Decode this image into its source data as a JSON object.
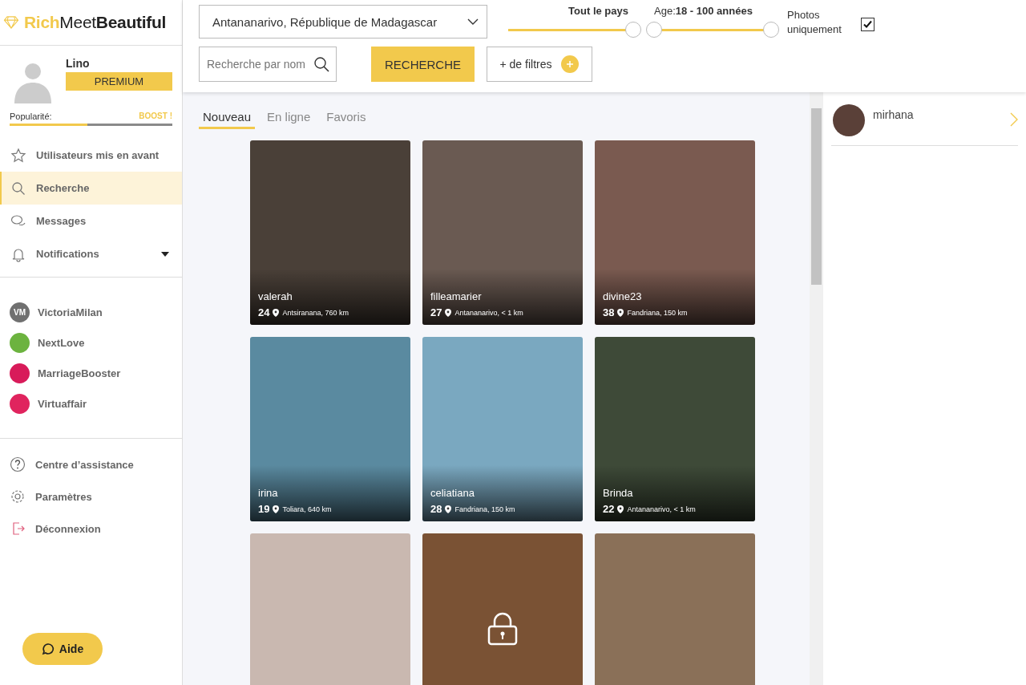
{
  "logo": {
    "part_1": "Rich",
    "part_2": "Meet",
    "part_3": "Beautiful"
  },
  "profile": {
    "name": "Lino",
    "badge": "PREMIUM",
    "popularity_label": "Popularité:",
    "boost": "BOOST !",
    "level": 0.48
  },
  "nav": [
    {
      "label": "Utilisateurs mis en avant",
      "selected": false
    },
    {
      "label": "Recherche",
      "selected": true
    },
    {
      "label": "Messages",
      "selected": false
    },
    {
      "label": "Notifications",
      "selected": false,
      "expandable": true
    }
  ],
  "partner_sites": [
    {
      "label": "VictoriaMilan",
      "badge": "VM",
      "color": "#707070"
    },
    {
      "label": "NextLove",
      "color": "#6cb33f"
    },
    {
      "label": "MarriageBooster",
      "color": "#d81b5a"
    },
    {
      "label": "Virtuaffair",
      "color": "#e0245e"
    }
  ],
  "footer_links": [
    {
      "label": "Centre d’assistance"
    },
    {
      "label": "Paramètres"
    },
    {
      "label": "Déconnexion"
    }
  ],
  "help_button": "Aide",
  "filters": {
    "location": "Antananarivo, République de Madagascar",
    "distance_label": "Tout le pays",
    "distance_level": {
      "level": 1
    },
    "age_prefix": "Age:",
    "age_range": "18 - 100 années",
    "age_level": {
      "level": 1
    },
    "photos_only": {
      "label": "Photos uniquement",
      "checked": true
    },
    "search_placeholder": "Recherche par nom",
    "search_button": "RECHERCHE",
    "more_filters": "+ de filtres"
  },
  "tabs": [
    {
      "label": "Nouveau",
      "selected": true
    },
    {
      "label": "En ligne",
      "selected": false
    },
    {
      "label": "Favoris",
      "selected": false
    }
  ],
  "profiles": [
    {
      "name": "valerah",
      "age": "24",
      "location": "Antsiranana, 760 km",
      "color": "#4a4038",
      "locked": false
    },
    {
      "name": "filleamarier",
      "age": "27",
      "location": "Antananarivo, < 1 km",
      "color": "#6a5a52",
      "locked": false
    },
    {
      "name": "divine23",
      "age": "38",
      "location": "Fandriana, 150 km",
      "color": "#7a5a50",
      "locked": false
    },
    {
      "name": "irina",
      "age": "19",
      "location": "Toliara, 640 km",
      "color": "#5a8aa0",
      "locked": false
    },
    {
      "name": "celiatiana",
      "age": "28",
      "location": "Fandriana, 150 km",
      "color": "#7aa8c0",
      "locked": false
    },
    {
      "name": "Brinda",
      "age": "22",
      "location": "Antananarivo, < 1 km",
      "color": "#3e4a38",
      "locked": false
    },
    {
      "color": "#c9b8b0",
      "locked": false
    },
    {
      "color": "#7a5234",
      "locked": true
    },
    {
      "color": "#8a7058",
      "locked": false
    }
  ],
  "conversations": [
    {
      "name": "mirhana"
    }
  ]
}
